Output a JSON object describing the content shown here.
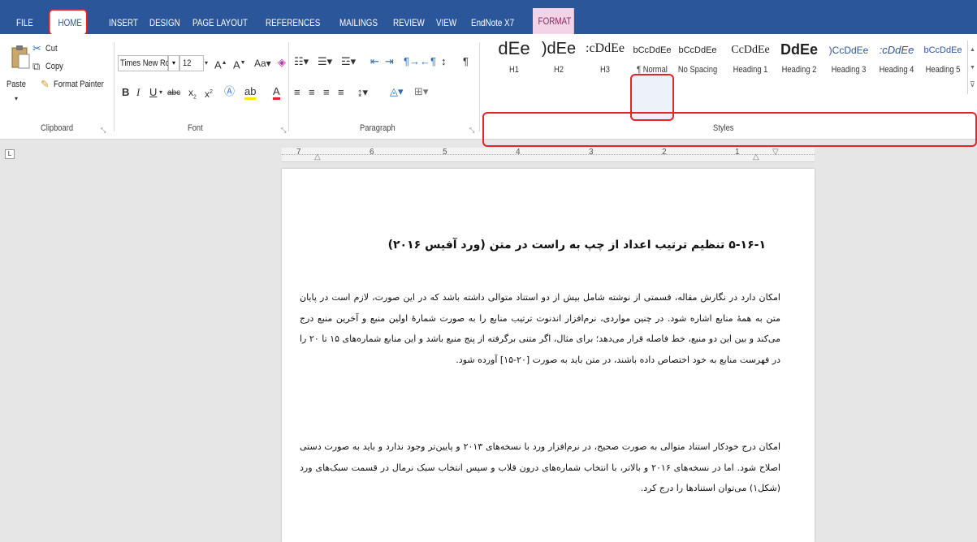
{
  "tabs": [
    "FILE",
    "HOME",
    "INSERT",
    "DESIGN",
    "PAGE LAYOUT",
    "REFERENCES",
    "MAILINGS",
    "REVIEW",
    "VIEW",
    "EndNote X7",
    "FORMAT"
  ],
  "clipboard": {
    "paste": "Paste",
    "cut": "Cut",
    "copy": "Copy",
    "format_painter": "Format Painter",
    "group_label": "Clipboard"
  },
  "font": {
    "name": "Times New Ro",
    "size": "12",
    "group_label": "Font"
  },
  "paragraph": {
    "group_label": "Paragraph"
  },
  "styles": {
    "group_label": "Styles",
    "items": [
      {
        "preview": "dEe",
        "name": "H1"
      },
      {
        "preview": ")dEe",
        "name": "H2"
      },
      {
        "preview": ":cDdEe",
        "name": "H3"
      },
      {
        "preview": "bCcDdEe",
        "name": "¶ Normal"
      },
      {
        "preview": "bCcDdEe",
        "name": "No Spacing"
      },
      {
        "preview": "CcDdEe",
        "name": "Heading 1"
      },
      {
        "preview": "DdEe",
        "name": "Heading 2"
      },
      {
        "preview": ")CcDdEe",
        "name": "Heading 3"
      },
      {
        "preview": ":cDdEe",
        "name": "Heading 4"
      },
      {
        "preview": "bCcDdEe",
        "name": "Heading 5"
      }
    ]
  },
  "ruler": {
    "numbers": [
      "7",
      "6",
      "5",
      "4",
      "3",
      "2",
      "1"
    ]
  },
  "document": {
    "heading": "۵-۱۶-۱ تنظیم ترتیب اعداد از چپ به راست در متن (ورد آفیس ۲۰۱۶)",
    "paragraph1": "امکان دارد در نگارش مقاله، قسمتی از نوشته شامل بیش از دو استناد متوالی داشته باشد که در این صورت، لازم است در پایان متن به همهٔ منابع اشاره شود. در چنین مواردی، نرم‌افزار اندنوت ترتیب منابع را به صورت شمارهٔ اولین منبع و آخرین منبع درج می‌کند و بین این دو منبع، خط فاصله قرار می‌دهد؛ برای مثال، اگر متنی برگرفته از پنج منبع باشد و این منابع شماره‌های ۱۵ تا ۲۰ را در فهرست منابع به خود اختصاص داده باشند، در متن باید به صورت [۲۰-۱۵] آورده شود.",
    "paragraph2": "امکان درج خودکار استناد متوالی به صورت صحیح، در نرم‌افزار ورد با نسخه‌های ۲۰۱۳ و پایین‌تر وجود ندارد و باید به صورت دستی اصلاح شود. اما در نسخه‌های ۲۰۱۶ و بالاتر، با انتخاب شماره‌های درون قلاب و سپس انتخاب سبک نرمال در قسمت سبک‌های ورد (شکل۱) می‌توان استنادها را درج کرد."
  },
  "colors": {
    "tab_bar": "#2b579a",
    "highlight": "#e3242b",
    "format_tab": "#f3d3e6"
  }
}
